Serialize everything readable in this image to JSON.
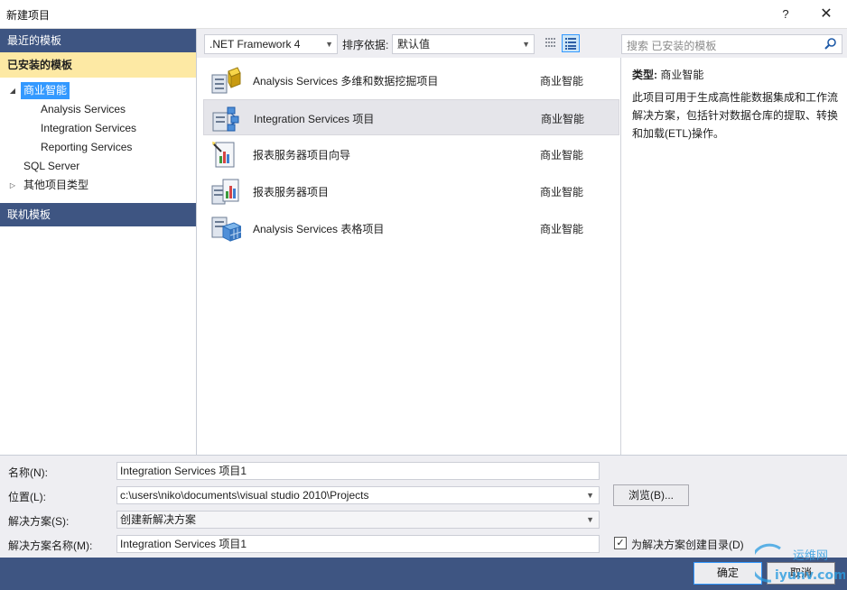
{
  "window": {
    "title": "新建项目",
    "help": "?",
    "close": "✕"
  },
  "sidebar": {
    "recent": "最近的模板",
    "installed": "已安装的模板",
    "tree": [
      {
        "label": "商业智能",
        "arrow": "◢",
        "level": 0,
        "selected": true
      },
      {
        "label": "Analysis Services",
        "arrow": "",
        "level": 1
      },
      {
        "label": "Integration Services",
        "arrow": "",
        "level": 1
      },
      {
        "label": "Reporting Services",
        "arrow": "",
        "level": 1
      },
      {
        "label": "SQL Server",
        "arrow": "",
        "level": 0
      },
      {
        "label": "其他项目类型",
        "arrow": "▷",
        "level": 0
      }
    ],
    "online": "联机模板"
  },
  "toolbar": {
    "framework": ".NET Framework 4",
    "sort_label": "排序依据:",
    "sort_value": "默认值",
    "search_placeholder": "搜索 已安装的模板"
  },
  "templates": [
    {
      "name": "Analysis Services 多维和数据挖掘项目",
      "category": "商业智能",
      "icon": "analysis-cube-icon",
      "selected": false
    },
    {
      "name": "Integration Services 项目",
      "category": "商业智能",
      "icon": "integration-services-icon",
      "selected": true
    },
    {
      "name": "报表服务器项目向导",
      "category": "商业智能",
      "icon": "report-wizard-icon",
      "selected": false
    },
    {
      "name": "报表服务器项目",
      "category": "商业智能",
      "icon": "report-project-icon",
      "selected": false
    },
    {
      "name": "Analysis Services 表格项目",
      "category": "商业智能",
      "icon": "tabular-project-icon",
      "selected": false
    }
  ],
  "details": {
    "type_label": "类型:",
    "type_value": "商业智能",
    "description": "此项目可用于生成高性能数据集成和工作流解决方案，包括针对数据仓库的提取、转换和加载(ETL)操作。"
  },
  "form": {
    "name_label": "名称(N):",
    "name_value": "Integration Services 项目1",
    "location_label": "位置(L):",
    "location_value": "c:\\users\\niko\\documents\\visual studio 2010\\Projects",
    "browse": "浏览(B)...",
    "solution_label": "解决方案(S):",
    "solution_value": "创建新解决方案",
    "solution_name_label": "解决方案名称(M):",
    "solution_name_value": "Integration Services 项目1",
    "create_dir_label": "为解决方案创建目录(D)",
    "create_dir_checked": true
  },
  "footer": {
    "ok": "确定",
    "cancel": "取消"
  },
  "watermark": {
    "line1": "运维网",
    "line2": "iyunv.com"
  },
  "colors": {
    "header": "#3e5582",
    "installed": "#fde9a4",
    "selection": "#3399ff"
  }
}
